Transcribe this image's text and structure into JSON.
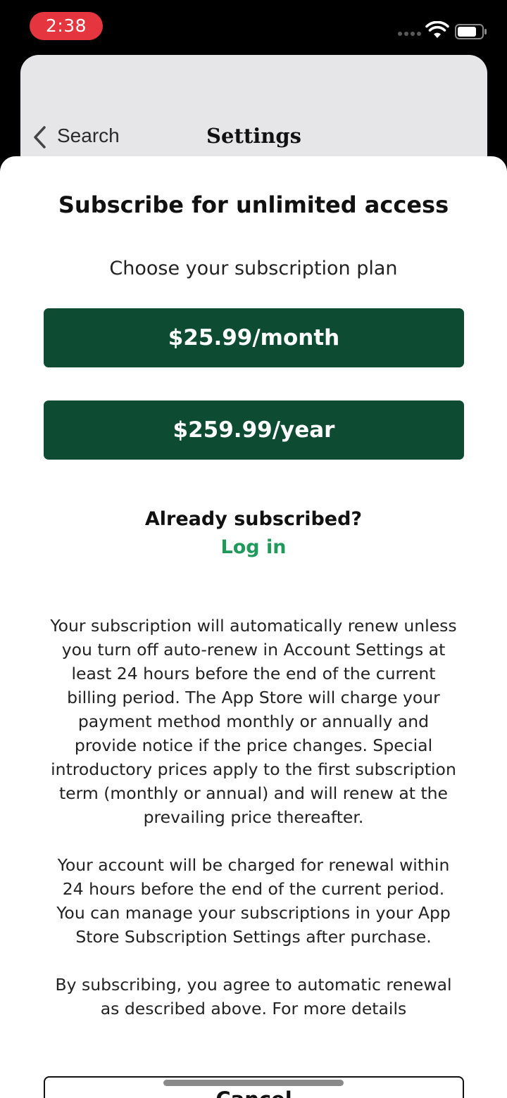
{
  "status_bar": {
    "time": "2:38"
  },
  "background_page": {
    "back_label": "Search",
    "title": "Settings"
  },
  "sheet": {
    "title": "Subscribe for unlimited access",
    "subtitle": "Choose your subscription plan",
    "plans": [
      {
        "label": "$25.99/month"
      },
      {
        "label": "$259.99/year"
      }
    ],
    "already_subscribed": "Already subscribed?",
    "login_label": "Log in",
    "terms": [
      "Your subscription will automatically renew unless you turn off auto-renew in Account Settings at least 24 hours before the end of the current billing period. The App Store will charge your payment method monthly or annually and provide notice if the price changes. Special introductory prices apply to the first subscription term (monthly or annual) and will renew at the prevailing price thereafter.",
      "Your account will be charged for renewal within 24 hours before the end of the current period. You can manage your subscriptions in your App Store Subscription Settings after purchase.",
      "By subscribing, you agree to automatic renewal as described above. For more details"
    ],
    "cancel_label": "Cancel"
  },
  "colors": {
    "plan_button": "#0d4b32",
    "login_link": "#1f9a5b",
    "time_pill": "#e5353e"
  },
  "icons": [
    "wifi-icon",
    "battery-icon",
    "back-chevron-icon",
    "signal-dots-icon"
  ]
}
